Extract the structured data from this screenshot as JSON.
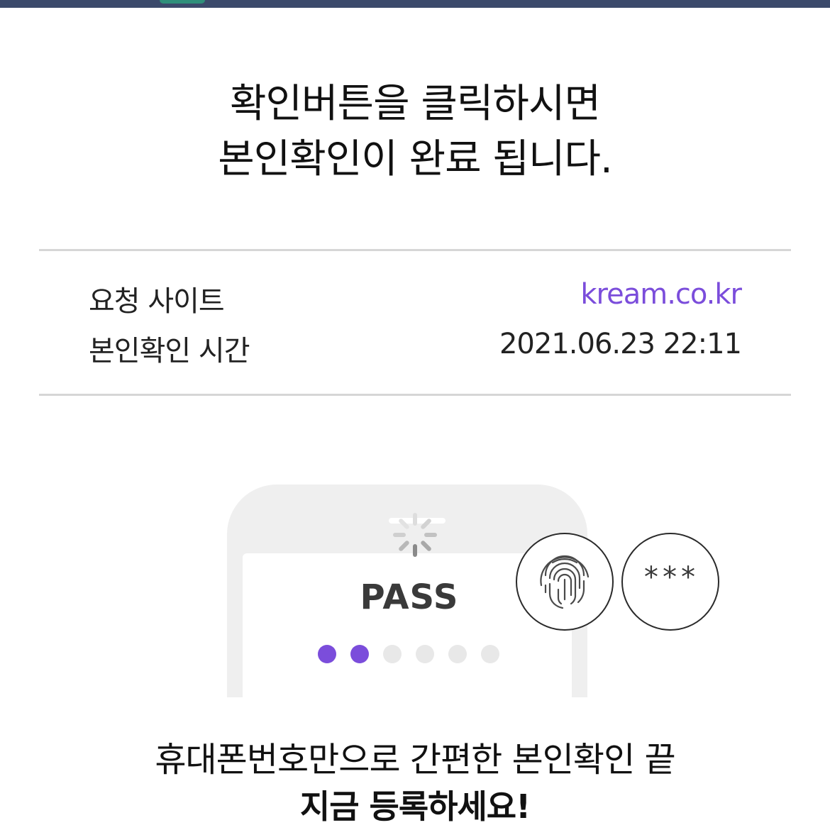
{
  "header": {
    "line1": "확인버튼을 클릭하시면",
    "line2": "본인확인이 완료 됩니다."
  },
  "info": {
    "site_label": "요청 사이트",
    "site_value": "kream.co.kr",
    "time_label": "본인확인 시간",
    "time_value": "2021.06.23 22:11"
  },
  "illustration": {
    "app_name": "PASS",
    "pin_dots_filled": 2,
    "pin_dots_total": 6,
    "password_mask": "***",
    "icons": [
      "loading-spinner-icon",
      "fingerprint-icon"
    ]
  },
  "promo": {
    "line1": "휴대폰번호만으로 간편한 본인확인 끝",
    "line2": "지금 등록하세요!"
  },
  "colors": {
    "accent": "#7b4ddb",
    "topbar": "#3b4a6b",
    "divider": "#d6d6d6",
    "phone": "#efefef"
  }
}
